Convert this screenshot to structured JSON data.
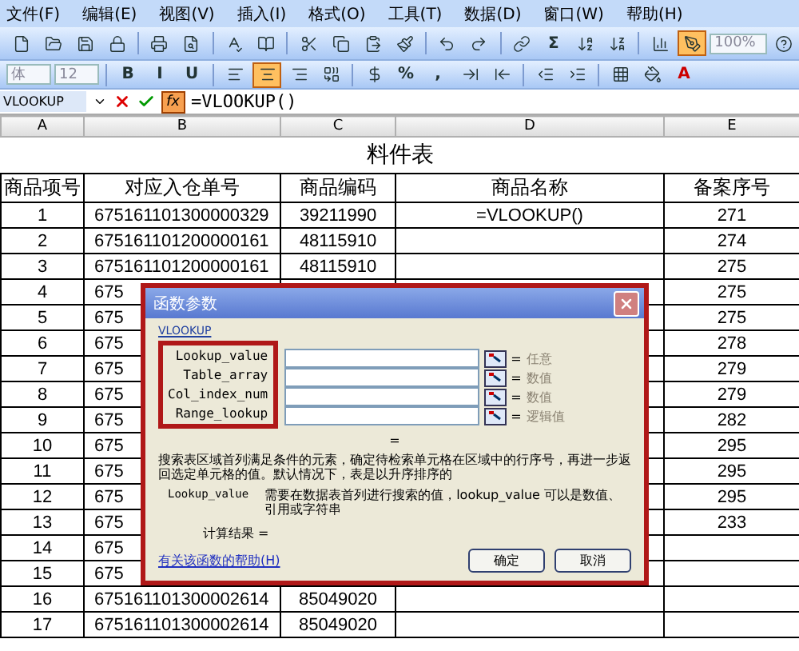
{
  "menu": [
    "文件(F)",
    "编辑(E)",
    "视图(V)",
    "插入(I)",
    "格式(O)",
    "工具(T)",
    "数据(D)",
    "窗口(W)",
    "帮助(H)"
  ],
  "standard_toolbar": [
    {
      "kind": "icon",
      "pressed": false
    },
    {
      "kind": "icon",
      "pressed": false
    },
    {
      "kind": "icon",
      "pressed": false
    },
    {
      "kind": "icon",
      "pressed": false
    },
    {
      "kind": "separator"
    },
    {
      "kind": "icon",
      "pressed": false
    },
    {
      "kind": "icon",
      "pressed": false
    },
    {
      "kind": "separator"
    },
    {
      "kind": "icon",
      "pressed": false
    },
    {
      "kind": "icon",
      "pressed": false
    },
    {
      "kind": "separator"
    },
    {
      "kind": "icon",
      "pressed": false
    },
    {
      "kind": "icon",
      "pressed": false
    },
    {
      "kind": "icon",
      "pressed": false
    },
    {
      "kind": "icon",
      "pressed": false
    },
    {
      "kind": "separator"
    },
    {
      "kind": "icon",
      "pressed": false
    },
    {
      "kind": "icon",
      "pressed": false
    },
    {
      "kind": "separator"
    },
    {
      "kind": "icon",
      "pressed": false
    },
    {
      "kind": "text",
      "label": "Σ",
      "pressed": false
    },
    {
      "kind": "icon",
      "pressed": false
    },
    {
      "kind": "icon",
      "pressed": false
    },
    {
      "kind": "separator"
    },
    {
      "kind": "icon",
      "pressed": false
    },
    {
      "kind": "icon",
      "pressed": true
    },
    {
      "kind": "field",
      "value": "100%"
    },
    {
      "kind": "icon",
      "pressed": false
    }
  ],
  "format_toolbar": [
    {
      "kind": "field",
      "value": "体"
    },
    {
      "kind": "field",
      "value": "12"
    },
    {
      "kind": "separator"
    },
    {
      "kind": "text",
      "label": "B",
      "pressed": false
    },
    {
      "kind": "text",
      "label": "I",
      "pressed": false
    },
    {
      "kind": "text",
      "label": "U",
      "pressed": false
    },
    {
      "kind": "separator"
    },
    {
      "kind": "icon",
      "pressed": false
    },
    {
      "kind": "icon",
      "pressed": true
    },
    {
      "kind": "icon",
      "pressed": false
    },
    {
      "kind": "icon",
      "pressed": false
    },
    {
      "kind": "separator"
    },
    {
      "kind": "icon",
      "pressed": false
    },
    {
      "kind": "text",
      "label": "%",
      "pressed": false
    },
    {
      "kind": "text",
      "label": ",",
      "pressed": false
    },
    {
      "kind": "icon",
      "pressed": false
    },
    {
      "kind": "icon",
      "pressed": false
    },
    {
      "kind": "separator"
    },
    {
      "kind": "icon",
      "pressed": false
    },
    {
      "kind": "icon",
      "pressed": false
    },
    {
      "kind": "separator"
    },
    {
      "kind": "icon",
      "pressed": false
    },
    {
      "kind": "icon",
      "pressed": false
    },
    {
      "kind": "text",
      "label": "A",
      "pressed": false
    }
  ],
  "formula_bar": {
    "name_box": "VLOOKUP",
    "function_button": "fx",
    "formula": "=VLOOKUP()"
  },
  "sheet": {
    "columns": [
      "A",
      "B",
      "C",
      "D",
      "E"
    ],
    "title": "料件表",
    "header": [
      "商品项号",
      "对应入仓单号",
      "商品编码",
      "商品名称",
      "备案序号"
    ],
    "rows": [
      [
        "1",
        "675161101300000329",
        "39211990",
        "=VLOOKUP()",
        "271"
      ],
      [
        "2",
        "675161101200000161",
        "48115910",
        "",
        "274"
      ],
      [
        "3",
        "675161101200000161",
        "48115910",
        "",
        "275"
      ],
      [
        "4",
        "675",
        "",
        "",
        "275"
      ],
      [
        "5",
        "675",
        "",
        "",
        "275"
      ],
      [
        "6",
        "675",
        "",
        "",
        "278"
      ],
      [
        "7",
        "675",
        "",
        "",
        "279"
      ],
      [
        "8",
        "675",
        "",
        "",
        "279"
      ],
      [
        "9",
        "675",
        "",
        "",
        "282"
      ],
      [
        "10",
        "675",
        "",
        "",
        "295"
      ],
      [
        "11",
        "675",
        "",
        "",
        "295"
      ],
      [
        "12",
        "675",
        "",
        "",
        "295"
      ],
      [
        "13",
        "675",
        "",
        "",
        "233"
      ],
      [
        "14",
        "675",
        "",
        "",
        ""
      ],
      [
        "15",
        "675",
        "",
        "",
        ""
      ],
      [
        "16",
        "675161101300002614",
        "85049020",
        "",
        ""
      ],
      [
        "17",
        "675161101300002614",
        "85049020",
        "",
        ""
      ]
    ]
  },
  "dialog": {
    "title": "函数参数",
    "function": "VLOOKUP",
    "params": [
      {
        "label": "Lookup_value",
        "sign": "=",
        "hint": "任意"
      },
      {
        "label": "Table_array",
        "sign": "=",
        "hint": "数值"
      },
      {
        "label": "Col_index_num",
        "sign": "=",
        "hint": "数值"
      },
      {
        "label": "Range_lookup",
        "sign": "=",
        "hint": "逻辑值"
      }
    ],
    "result_sign": "=",
    "description": "搜索表区域首列满足条件的元素，确定待检索单元格在区域中的行序号，再进一步返回选定单元格的值。默认情况下，表是以升序排序的",
    "arg_name": "Lookup_value",
    "arg_description": "需要在数据表首列进行搜索的值，lookup_value 可以是数值、引用或字符串",
    "result": "计算结果 =",
    "help_link": "有关该函数的帮助(H)",
    "buttons": [
      "确定",
      "取消"
    ]
  }
}
